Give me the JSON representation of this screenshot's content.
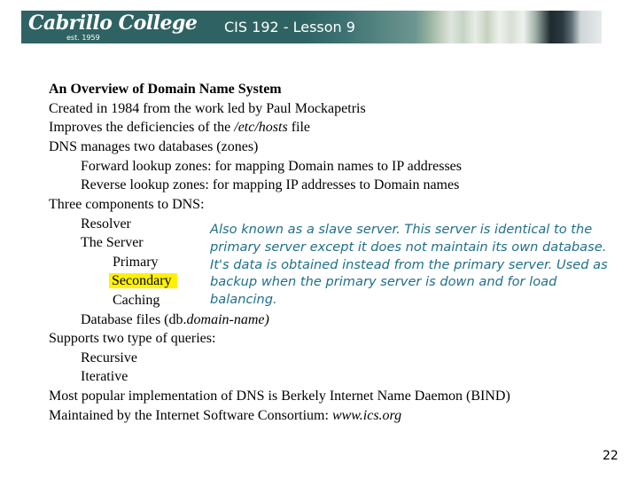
{
  "header": {
    "logo_text": "Cabrillo College",
    "logo_subtext": "est. 1959",
    "title": "CIS 192 - Lesson 9"
  },
  "content": {
    "heading": "An Overview of Domain Name System",
    "lines": [
      {
        "text": "Created in 1984 from the work led by Paul Mockapetris"
      },
      {
        "prefix": "Improves the deficiencies of the ",
        "italic": "/etc/hosts",
        "suffix": " file"
      },
      {
        "text": "DNS manages two databases (zones)"
      },
      {
        "text": "Forward lookup zones: for mapping Domain names to IP addresses"
      },
      {
        "text": "Reverse lookup zones: for mapping IP addresses to Domain names"
      },
      {
        "text": "Three components to DNS:"
      },
      {
        "text": "Resolver"
      },
      {
        "text": "The Server"
      },
      {
        "text": "Primary"
      },
      {
        "text": "Secondary",
        "highlighted": true
      },
      {
        "text": "Caching"
      },
      {
        "prefix": "Database files (db.",
        "italic": "domain-name)"
      },
      {
        "text": "Supports two type of queries:"
      },
      {
        "text": "Recursive"
      },
      {
        "text": "Iterative"
      },
      {
        "text": "Most popular implementation of DNS is Berkely Internet Name Daemon (BIND)"
      },
      {
        "prefix": "Maintained by the Internet Software Consortium: ",
        "italic": "www.ics.org"
      }
    ],
    "note": "Also known as a slave server.  This server  is identical to the primary server except it does not maintain its own database.  It's data is obtained instead from the primary server.  Used as backup when the primary server is down and for load balancing.",
    "highlight_color": "#fff200",
    "note_color": "#1f6f8b"
  },
  "footer": {
    "page_number": "22"
  }
}
